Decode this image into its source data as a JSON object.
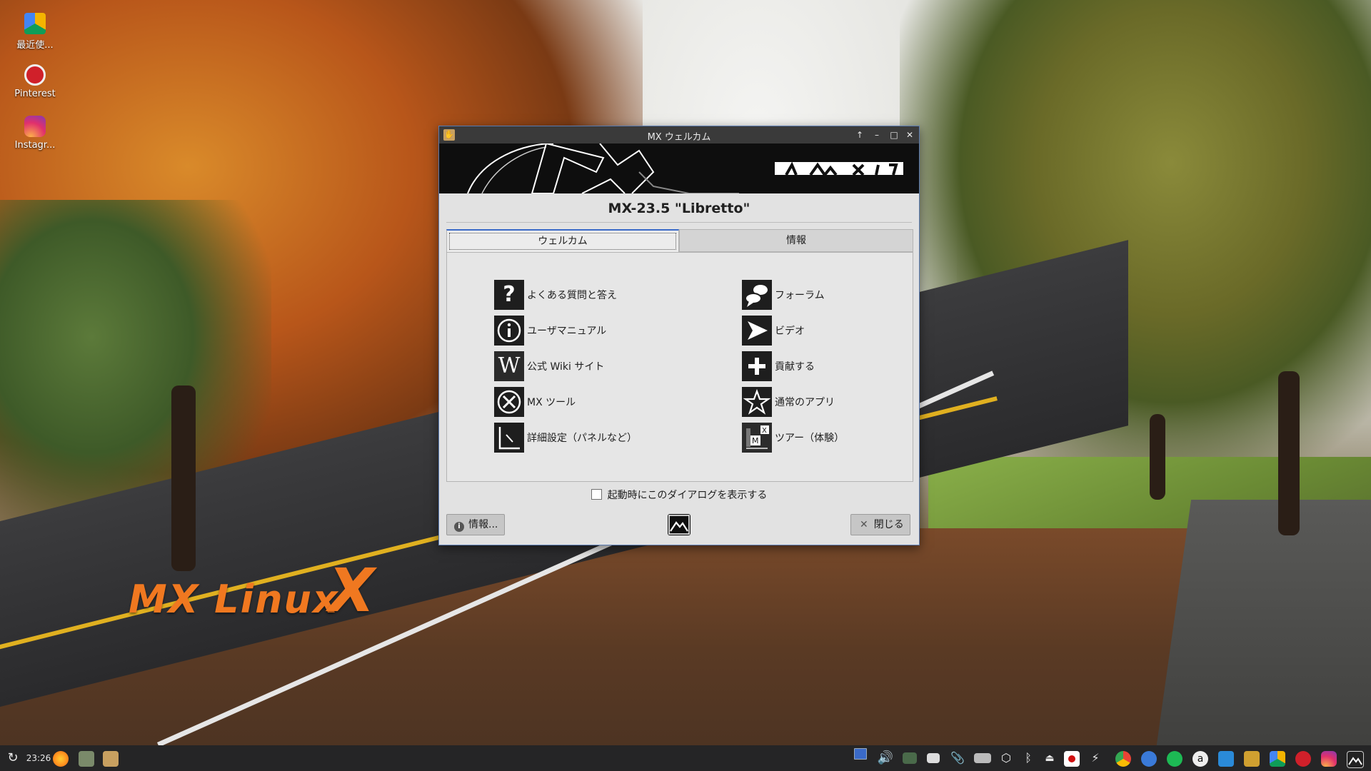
{
  "desktop": {
    "icons": [
      {
        "label": "最近使..."
      },
      {
        "label": "Pinterest"
      },
      {
        "label": "Instagr..."
      }
    ],
    "wallpaper_logo": "MX Linux"
  },
  "window": {
    "title": "MX ウェルカム",
    "version_title": "MX-23.5 \"Libretto\"",
    "tabs": [
      {
        "label": "ウェルカム"
      },
      {
        "label": "情報"
      }
    ],
    "items": [
      {
        "label": "よくある質問と答え",
        "icon": "question-icon"
      },
      {
        "label": "フォーラム",
        "icon": "speech-bubble-icon"
      },
      {
        "label": "ユーザマニュアル",
        "icon": "info-icon"
      },
      {
        "label": "ビデオ",
        "icon": "play-icon"
      },
      {
        "label": "公式 Wiki サイト",
        "icon": "wiki-icon"
      },
      {
        "label": "貢献する",
        "icon": "plus-icon"
      },
      {
        "label": "MX ツール",
        "icon": "tools-icon"
      },
      {
        "label": "通常のアプリ",
        "icon": "star-icon"
      },
      {
        "label": "詳細設定（パネルなど）",
        "icon": "settings-icon"
      },
      {
        "label": "ツアー（体験）",
        "icon": "tour-icon"
      }
    ],
    "show_on_startup_label": "起動時にこのダイアログを表示する",
    "show_on_startup_checked": false,
    "about_button": "情報...",
    "close_button": "閉じる"
  },
  "taskbar": {
    "clock": "23:26"
  }
}
